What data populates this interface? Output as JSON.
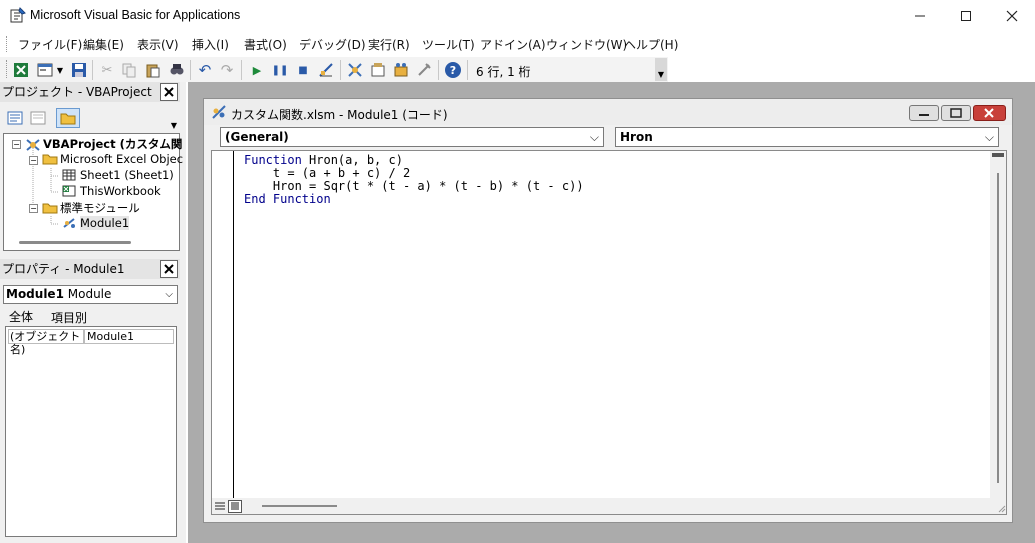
{
  "window": {
    "title": "Microsoft Visual Basic for Applications",
    "min": "—",
    "max": "☐",
    "close": "✕"
  },
  "menu": [
    "ファイル(F)",
    "編集(E)",
    "表示(V)",
    "挿入(I)",
    "書式(O)",
    "デバッグ(D)",
    "実行(R)",
    "ツール(T)",
    "アドイン(A)",
    "ウィンドウ(W)",
    "ヘルプ(H)"
  ],
  "toolbar": {
    "position": "6 行, 1 桁"
  },
  "project_panel": {
    "title": "プロジェクト - VBAProject",
    "close": "✕",
    "tree": {
      "root": "VBAProject (カスタム関",
      "excel_objects": "Microsoft Excel Objec",
      "sheet1": "Sheet1 (Sheet1)",
      "thisworkbook": "ThisWorkbook",
      "modules": "標準モジュール",
      "module1": "Module1"
    }
  },
  "properties_panel": {
    "title": "プロパティ - Module1",
    "close": "✕",
    "object_name": "Module1",
    "object_type": "Module",
    "tab_all": "全体",
    "tab_category": "項目別",
    "prop_name": "(オブジェクト名)",
    "prop_value": "Module1"
  },
  "code_window": {
    "title": "カスタム関数.xlsm - Module1 (コード)",
    "object_combo": "(General)",
    "proc_combo": "Hron",
    "lines": [
      {
        "kw1": "Function",
        "rest": " Hron(a, b, c)"
      },
      {
        "kw1": "",
        "rest": "    t = (a + b + c) / 2"
      },
      {
        "kw1": "",
        "rest": "    Hron = Sqr(t * (t - a) * (t - b) * (t - c))"
      },
      {
        "kw1": "End Function",
        "rest": ""
      }
    ]
  }
}
